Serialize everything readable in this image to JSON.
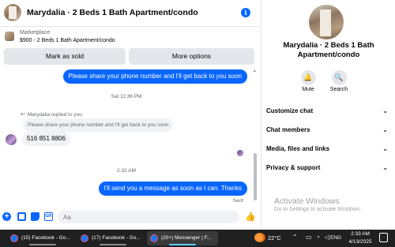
{
  "header": {
    "title": "Marydalia · 2 Beds 1 Bath Apartment/condo"
  },
  "listing": {
    "marketplace_label": "Marketplace",
    "price_title": "$900 - 2 Beds 1 Bath Apartment/condo",
    "mark_sold_label": "Mark as sold",
    "more_options_label": "More options"
  },
  "messages": {
    "outgoing_1": "Please share your phone number and I'll get back to you soon",
    "timestamp_1": "Sat 11:36 PM",
    "reply_label": "Marydalia replied to you",
    "quoted_text": "Please share your phone number and I'll get back to you soon",
    "incoming_1": "516 851 8806",
    "timestamp_2": "2:32 AM",
    "outgoing_2": "I'll send you a message as soon as I can. Thanks",
    "status": "Sent"
  },
  "composer": {
    "placeholder": "Aa"
  },
  "panel": {
    "title": "Marydalia · 2 Beds 1 Bath Apartment/condo",
    "mute_label": "Mute",
    "search_label": "Search",
    "sections": [
      "Customize chat",
      "Chat members",
      "Media, files and links",
      "Privacy & support"
    ]
  },
  "watermark": {
    "title": "Activate Windows",
    "subtitle": "Go to Settings to activate Windows."
  },
  "taskbar": {
    "tasks": [
      "(15) Facebook - Go...",
      "(17) Facebook - Go...",
      "(20+) Messenger | F..."
    ],
    "temperature": "22°C",
    "language": "ENG",
    "time": "2:33 AM",
    "date": "4/13/2025"
  },
  "colors": {
    "accent": "#0866ff",
    "bubble_in": "#f0f2f5",
    "taskbar": "#202020"
  },
  "icons": [
    "info-icon",
    "plus-icon",
    "photo-icon",
    "sticker-icon",
    "gif-icon",
    "like-icon",
    "bell-icon",
    "search-icon",
    "chevron-down-icon",
    "reply-arrow-icon",
    "weather-icon",
    "wifi-icon",
    "volume-icon",
    "notification-icon"
  ]
}
